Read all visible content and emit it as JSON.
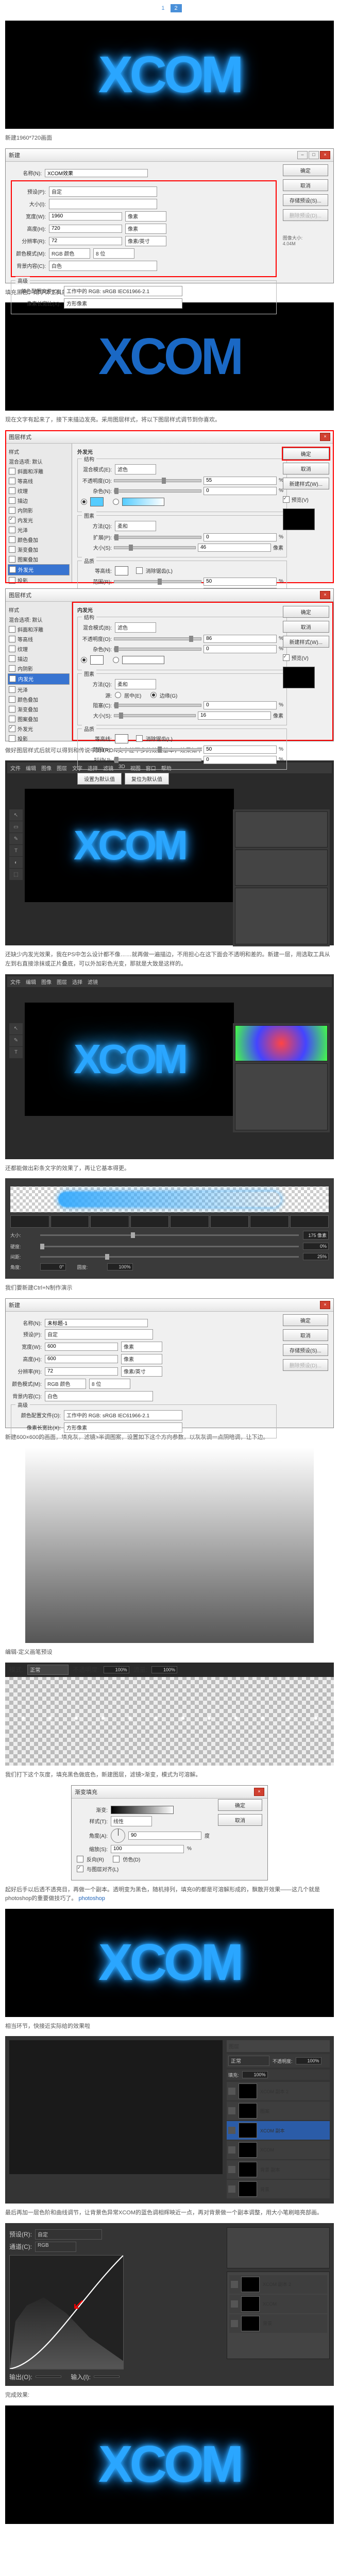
{
  "tabs": {
    "t1": "1",
    "t2": "2"
  },
  "logo": "XCOM",
  "p_new": "新建1960*720画面",
  "dlg_new": {
    "title": "新建",
    "name_lbl": "名称(N):",
    "name_val": "XCOM效果",
    "preset_lbl": "预设(P):",
    "preset_val": "自定",
    "size_lbl": "大小(I):",
    "w_lbl": "宽度(W):",
    "w_val": "1960",
    "h_lbl": "高度(H):",
    "h_val": "720",
    "unit": "像素",
    "res_lbl": "分辨率(R):",
    "res_val": "72",
    "res_unit": "像素/英寸",
    "mode_lbl": "颜色模式(M):",
    "mode_val": "RGB 颜色",
    "depth": "8 位",
    "bg_lbl": "背景内容(C):",
    "bg_val": "白色",
    "adv": "高级",
    "profile_lbl": "颜色配置文件(O):",
    "profile_val": "工作中的 RGB: sRGB IEC61966-2.1",
    "aspect_lbl": "像素长宽比(X):",
    "aspect_val": "方形像素",
    "size_info": "图像大小:",
    "size_num": "4.04M",
    "ok": "确定",
    "cancel": "取消",
    "save_preset": "存储预设(S)...",
    "del_preset": "删除预设(D)..."
  },
  "p_bg": "填充黑色，用字体工具敲XCOM四个字母",
  "p_afterfont": "现在文字有起来了，接下来描边发亮。采用图层样式，将以下图层样式调节到你喜欢。",
  "ls": {
    "title": "图层样式",
    "left": [
      "样式",
      "混合选项: 默认",
      "斜面和浮雕",
      "等高线",
      "纹理",
      "描边",
      "内阴影",
      "内发光",
      "光泽",
      "颜色叠加",
      "渐变叠加",
      "图案叠加",
      "外发光",
      "投影"
    ],
    "outer": {
      "hdr": "外发光",
      "struct": "结构",
      "blend_lbl": "混合模式(E):",
      "blend_val": "滤色",
      "opacity_lbl": "不透明度(O):",
      "opacity_val": "55",
      "noise_lbl": "杂色(N):",
      "noise_val": "0",
      "elem": "图素",
      "tech_lbl": "方法(Q):",
      "tech_val": "柔和",
      "spread_lbl": "扩展(P):",
      "spread_val": "0",
      "size_lbl": "大小(S):",
      "size_val": "46",
      "quality": "品质",
      "contour_lbl": "等高线:",
      "anti": "消除锯齿(L)",
      "range_lbl": "范围(R):",
      "range_val": "50",
      "jitter_lbl": "抖动(J):",
      "jitter_val": "0",
      "pct": "%",
      "px": "像素",
      "reset": "设置为默认值",
      "makedef": "复位为默认值"
    },
    "inner": {
      "hdr": "内发光",
      "struct": "结构",
      "blend_lbl": "混合模式(B):",
      "blend_val": "滤色",
      "opacity_lbl": "不透明度(O):",
      "opacity_val": "86",
      "noise_lbl": "杂色(N):",
      "noise_val": "0",
      "elem": "图素",
      "tech_lbl": "方法(Q):",
      "tech_val": "柔和",
      "source_lbl": "源:",
      "center": "居中(E)",
      "edge": "边缘(G)",
      "choke_lbl": "阻塞(C):",
      "choke_val": "0",
      "size_lbl": "大小(S):",
      "size_val": "16",
      "quality": "品质",
      "contour_lbl": "等高线:",
      "anti": "消除锯齿(L)",
      "range_lbl": "范围(R):",
      "range_val": "50",
      "jitter_lbl": "抖动(J):",
      "jitter_val": "0"
    },
    "ok": "确定",
    "cancel": "取消",
    "newstyle": "新建样式(W)...",
    "preview": "预览(V)"
  },
  "p_afterls": "做好图层样式后就可以得到和传说中的TRON文字差不多的效果基本，效果如下：",
  "p_dup": "还缺少内发光效果，我在PS中怎么设计都不像……就再做一遍描边，不用担心在这下面会不透明和差的。新建一层，用选取工具从左到右直接涂抹或正片叠底，可以外加彩色光变，那就是大致是这样的。",
  "ps": {
    "menus": [
      "文件",
      "编辑",
      "图像",
      "图层",
      "文字",
      "选择",
      "滤镜",
      "3D",
      "视图",
      "窗口",
      "帮助"
    ]
  },
  "p_brush": "还都能做出彩条文字的效果了，再让它基本得更。",
  "brush": {
    "size_lbl": "大小:",
    "size_val": "175 像素",
    "hard_lbl": "硬度:",
    "hard_val": "0%",
    "spacing_lbl": "间距:",
    "spacing_val": "25%",
    "angle_lbl": "角度:",
    "angle_val": "0°",
    "round_lbl": "圆度:",
    "round_val": "100%"
  },
  "p_newdoc2": "我们要新建Ctrl+N制作演示",
  "dlg_new2": {
    "title": "新建",
    "name_val": "未标题-1",
    "w_val": "600",
    "h_val": "600",
    "res_val": "72"
  },
  "p_grid": "新建600×600的画面，填充灰，滤镜>半调图案，设置如下这个方向参数，以灰灰调一点阴暗调，让下边。",
  "p_savebrush": "编辑-定义画笔预设",
  "bar": {
    "mode_lbl": "模式:",
    "mode_val": "正常",
    "opac_lbl": "不透明度:",
    "opac_val": "100%",
    "flow_lbl": "流量:",
    "flow_val": "100%"
  },
  "p_grad": "我们打下这个灰度，填充黑色做底色，新建图层，滤镜>渐变，模式为可溶解。",
  "dlg_grad": {
    "title": "渐变填充",
    "grad_lbl": "渐变:",
    "style_lbl": "样式(T):",
    "style_val": "线性",
    "angle_lbl": "角度(A):",
    "angle_val": "90",
    "deg": "度",
    "scale_lbl": "缩放(S):",
    "scale_val": "100",
    "rev": "反向(R)",
    "dither": "仿色(D)",
    "align": "与图层对齐(L)",
    "ok": "确定",
    "cancel": "取消"
  },
  "p_after_grad": "起好后手以后透不透亮目，再做一个副本。透明变为黑色，随机排列，填充0的都是可溶解形成的，飘散开效果——这几个就是photoshop的重要做技巧了。",
  "p_layers": "相当环节，快接近实际给的效果啦",
  "layers": {
    "title": "图层",
    "mode_val": "正常",
    "opac_lbl": "不透明度:",
    "opac_val": "100%",
    "fill_lbl": "填充:",
    "fill_val": "100%",
    "items": [
      "XCOM 副本 2",
      "图案",
      "XCOM 副本",
      "XCOM",
      "背景 副本",
      "背景"
    ]
  },
  "p_curves": "最后再加一层色阶和曲线调节，让背景色异常XCOM的蓝色调相辉映近一点，再对背景做一个副本调整，用大小笔刷暗亮部画。",
  "curves": {
    "title": "曲线",
    "preset_lbl": "预设(R):",
    "preset_val": "自定",
    "chan_lbl": "通道(C):",
    "chan_val": "RGB",
    "output_lbl": "输出(O):",
    "input_lbl": "输入(I):"
  },
  "p_final": "完成效果:"
}
